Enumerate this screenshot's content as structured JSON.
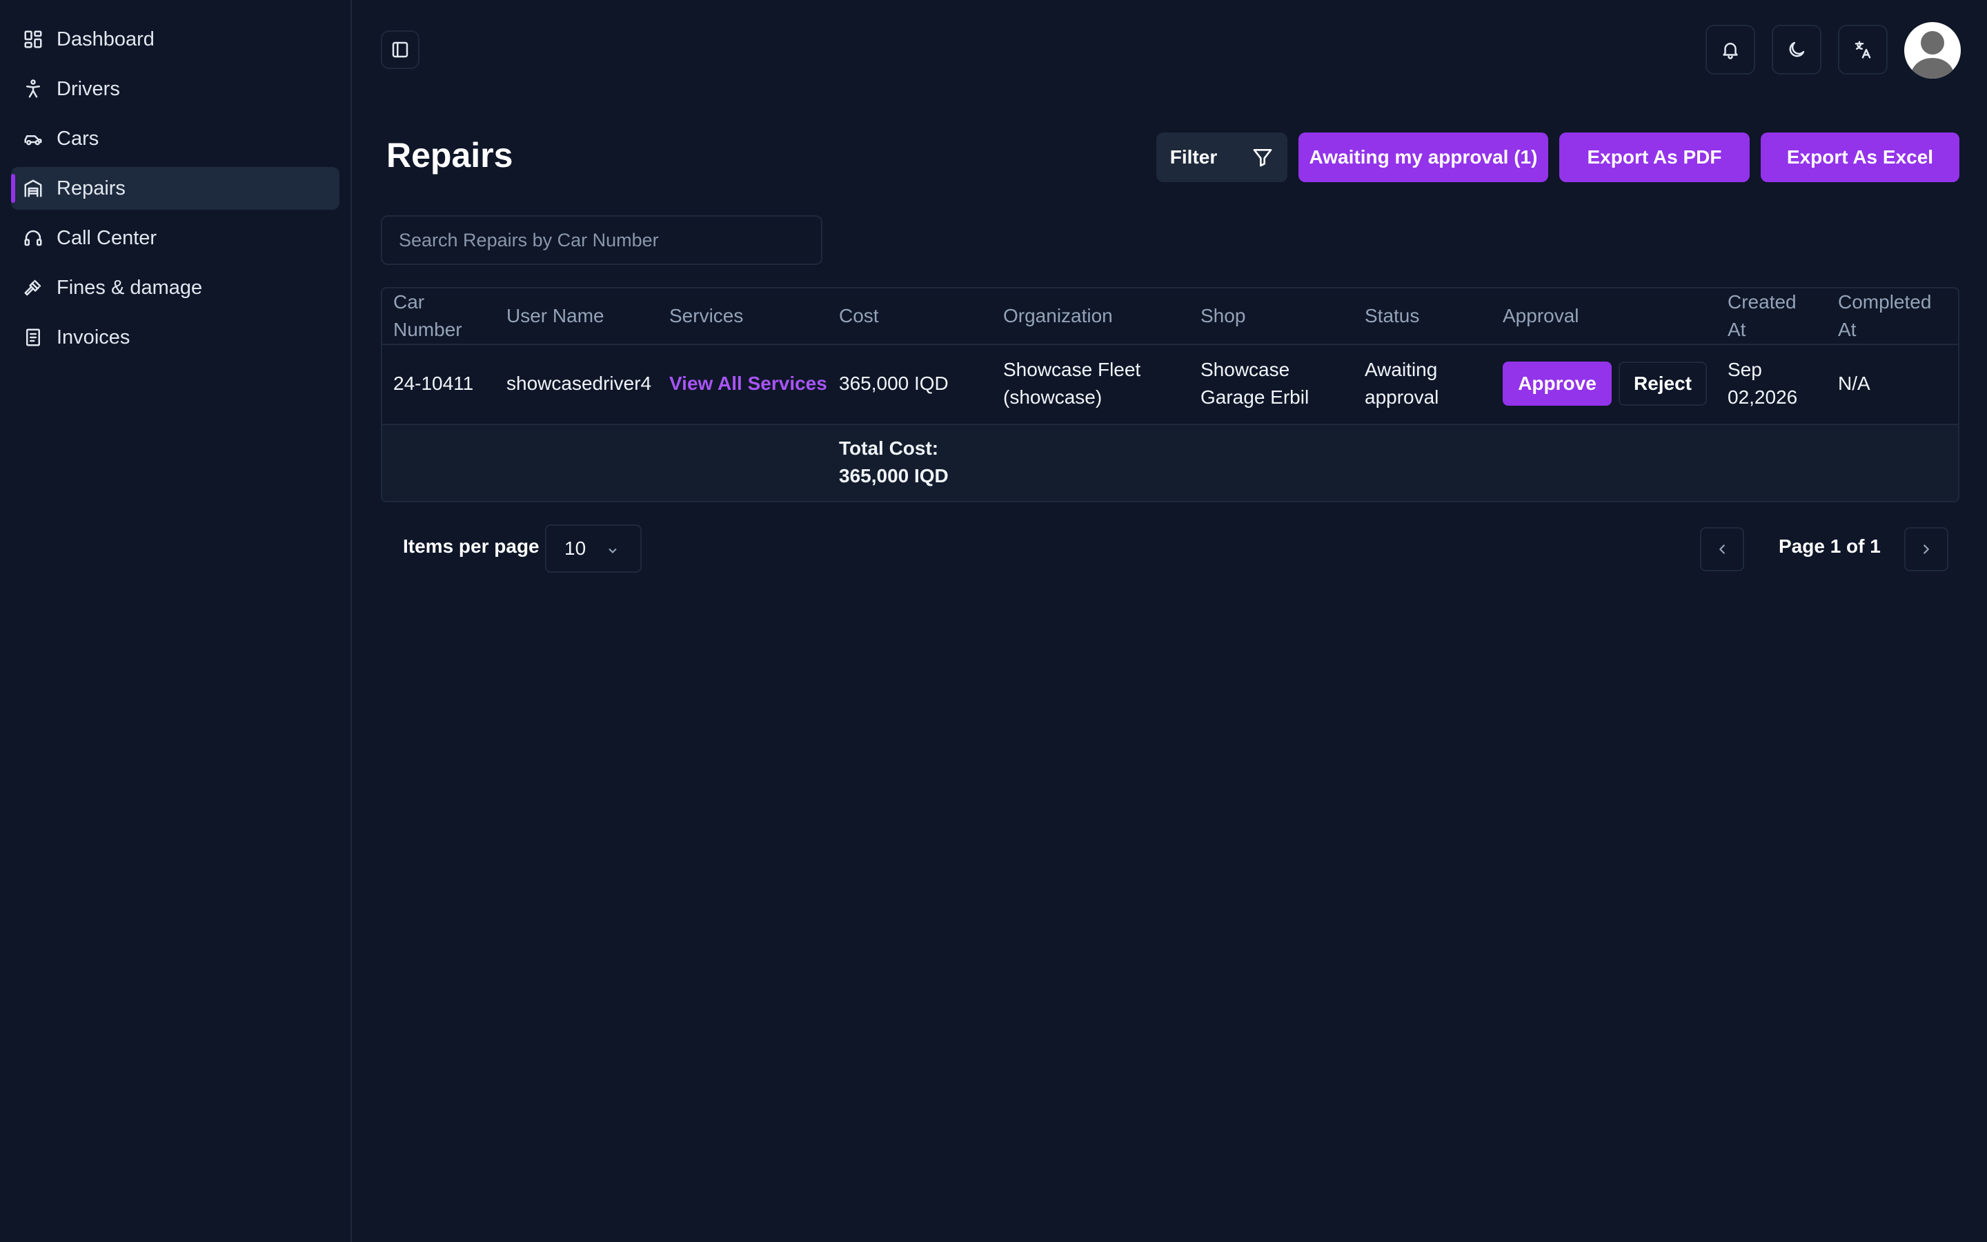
{
  "sidebar": {
    "items": [
      {
        "label": "Dashboard",
        "icon": "dashboard-icon",
        "active": false
      },
      {
        "label": "Drivers",
        "icon": "person-icon",
        "active": false
      },
      {
        "label": "Cars",
        "icon": "car-icon",
        "active": false
      },
      {
        "label": "Repairs",
        "icon": "garage-icon",
        "active": true
      },
      {
        "label": "Call Center",
        "icon": "headset-icon",
        "active": false
      },
      {
        "label": "Fines & damage",
        "icon": "gavel-icon",
        "active": false
      },
      {
        "label": "Invoices",
        "icon": "invoice-icon",
        "active": false
      }
    ]
  },
  "topbar": {
    "sidebar_toggle_icon": "sidebar-toggle-icon",
    "notifications_icon": "bell-icon",
    "theme_icon": "moon-icon",
    "language_icon": "translate-icon",
    "avatar_icon": "user-avatar-icon"
  },
  "page": {
    "title": "Repairs",
    "filter_label": "Filter",
    "awaiting_label": "Awaiting my approval (1)",
    "export_pdf_label": "Export As PDF",
    "export_excel_label": "Export As Excel",
    "search_placeholder": "Search Repairs by Car Number"
  },
  "table": {
    "headers": {
      "car_number": [
        "Car",
        "Number"
      ],
      "user_name": "User Name",
      "services": "Services",
      "cost": "Cost",
      "organization": "Organization",
      "shop": "Shop",
      "status": "Status",
      "approval": "Approval",
      "created_at": [
        "Created",
        "At"
      ],
      "completed_at": [
        "Completed",
        "At"
      ]
    },
    "rows": [
      {
        "car_number": "24-10411",
        "user_name": "showcasedriver4",
        "services_link": "View All Services",
        "cost": "365,000 IQD",
        "organization": [
          "Showcase Fleet",
          "(showcase)"
        ],
        "shop": [
          "Showcase",
          "Garage Erbil"
        ],
        "status": [
          "Awaiting",
          "approval"
        ],
        "approve_label": "Approve",
        "reject_label": "Reject",
        "created_at": [
          "Sep",
          "02,2026"
        ],
        "completed_at": "N/A"
      }
    ],
    "total": [
      "Total Cost:",
      "365,000 IQD"
    ]
  },
  "footer": {
    "items_per_page_label": "Items per page",
    "items_per_page_value": "10",
    "page_info": "Page 1 of 1"
  },
  "colors": {
    "accent": "#9333ea",
    "background": "#0e1628",
    "border": "#1e293b"
  }
}
